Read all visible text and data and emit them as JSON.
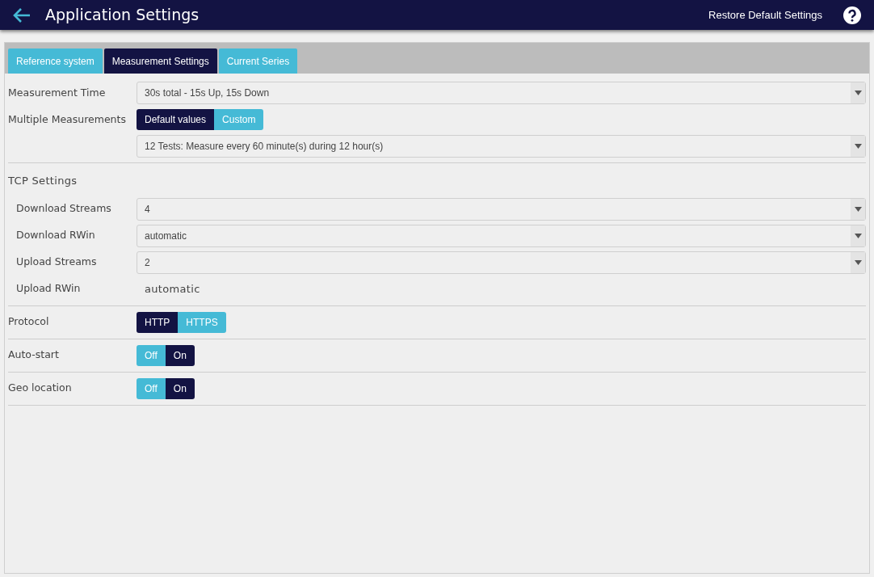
{
  "header": {
    "title": "Application Settings",
    "action": "Restore Default Settings"
  },
  "tabs": [
    {
      "label": "Reference system",
      "selected": false
    },
    {
      "label": "Measurement Settings",
      "selected": true
    },
    {
      "label": "Current Series",
      "selected": false
    }
  ],
  "sections": [
    {
      "rows": [
        {
          "kind": "select",
          "label": "Measurement Time",
          "value": "30s total - 15s Up, 15s Down"
        },
        {
          "kind": "segmented",
          "label": "Multiple Measurements",
          "options": [
            {
              "label": "Default values",
              "selected": true
            },
            {
              "label": "Custom",
              "selected": false
            }
          ]
        },
        {
          "kind": "select",
          "value": "12 Tests: Measure every 60 minute(s) during 12 hour(s)"
        }
      ]
    },
    {
      "heading": "TCP Settings",
      "rows": [
        {
          "kind": "select",
          "label": "Download Streams",
          "value": "4"
        },
        {
          "kind": "select",
          "label": "Download RWin",
          "value": "automatic"
        },
        {
          "kind": "select",
          "label": "Upload Streams",
          "value": "2"
        },
        {
          "kind": "text",
          "label": "Upload RWin",
          "value": "automatic"
        }
      ]
    },
    {
      "rows": [
        {
          "kind": "segmented",
          "label": "Protocol",
          "options": [
            {
              "label": "HTTP",
              "selected": true
            },
            {
              "label": "HTTPS",
              "selected": false
            }
          ]
        }
      ]
    },
    {
      "rows": [
        {
          "kind": "segmented",
          "label": "Auto-start",
          "options": [
            {
              "label": "Off",
              "selected": false
            },
            {
              "label": "On",
              "selected": true
            }
          ]
        }
      ]
    },
    {
      "rows": [
        {
          "kind": "segmented",
          "label": "Geo location",
          "options": [
            {
              "label": "Off",
              "selected": false
            },
            {
              "label": "On",
              "selected": true
            }
          ]
        }
      ]
    }
  ]
}
